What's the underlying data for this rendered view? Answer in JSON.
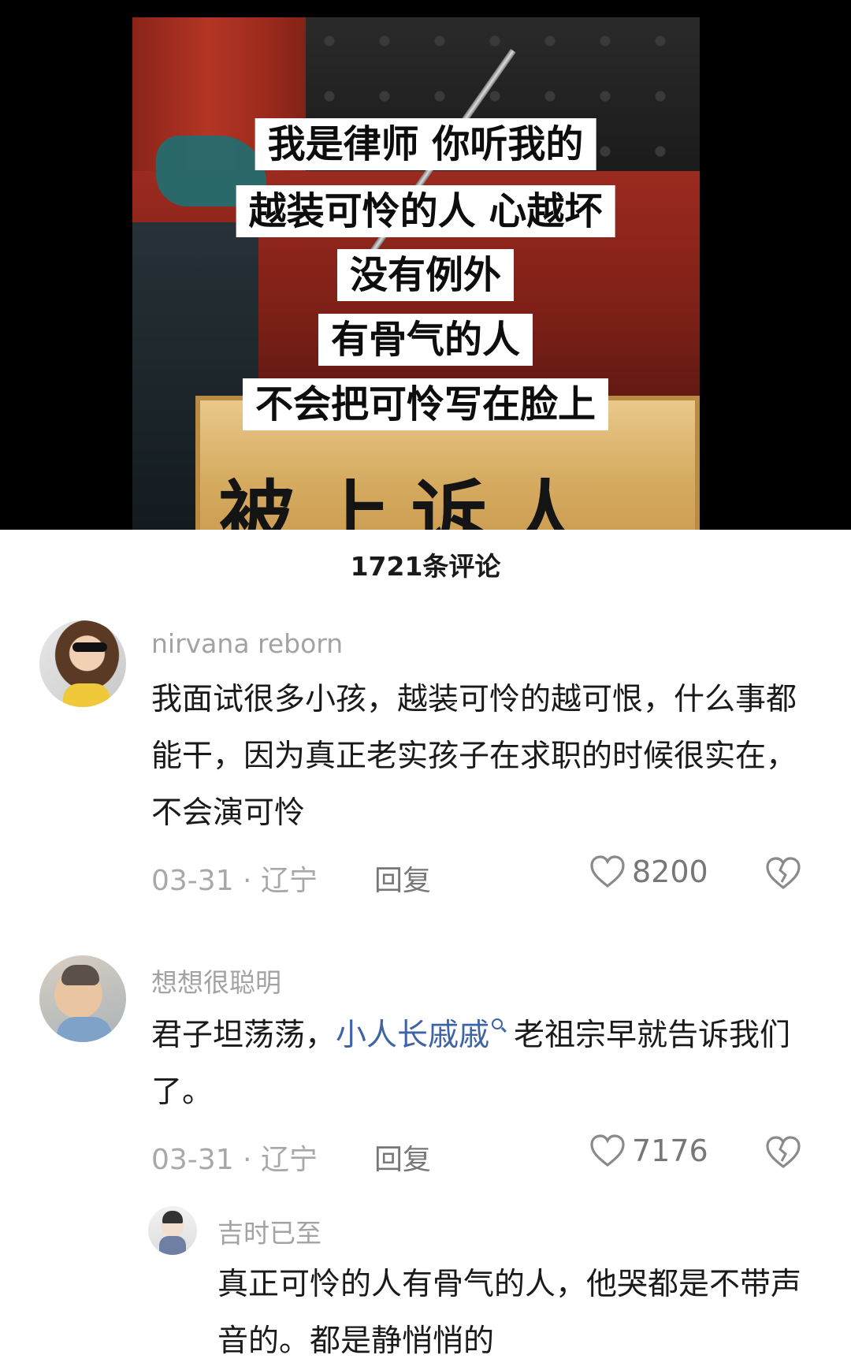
{
  "video": {
    "captions": [
      "我是律师 你听我的",
      "越装可怜的人 心越坏",
      "没有例外",
      "有骨气的人",
      "不会把可怜写在脸上"
    ],
    "plate_text": "被上诉人"
  },
  "comments_header": {
    "count_label": "1721条评论"
  },
  "comments": [
    {
      "username": "nirvana reborn",
      "text": "我面试很多小孩，越装可怜的越可恨，什么事都能干，因为真正老实孩子在求职的时候很实在，不会演可怜",
      "meta": "03-31 · 辽宁",
      "reply_label": "回复",
      "likes": "8200"
    },
    {
      "username": "想想很聪明",
      "text_before": "君子坦荡荡，",
      "link_text": "小人长戚戚",
      "text_after": "老祖宗早就告诉我们了。",
      "meta": "03-31 · 辽宁",
      "reply_label": "回复",
      "likes": "7176"
    },
    {
      "username": "吉时已至",
      "text": "真正可怜的人有骨气的人，他哭都是不带声音的。都是静悄悄的"
    }
  ],
  "colors": {
    "link": "#3e63a6",
    "muted": "#a8a8a8"
  },
  "icons": [
    "heart-outline-icon",
    "broken-heart-icon",
    "search-icon"
  ]
}
